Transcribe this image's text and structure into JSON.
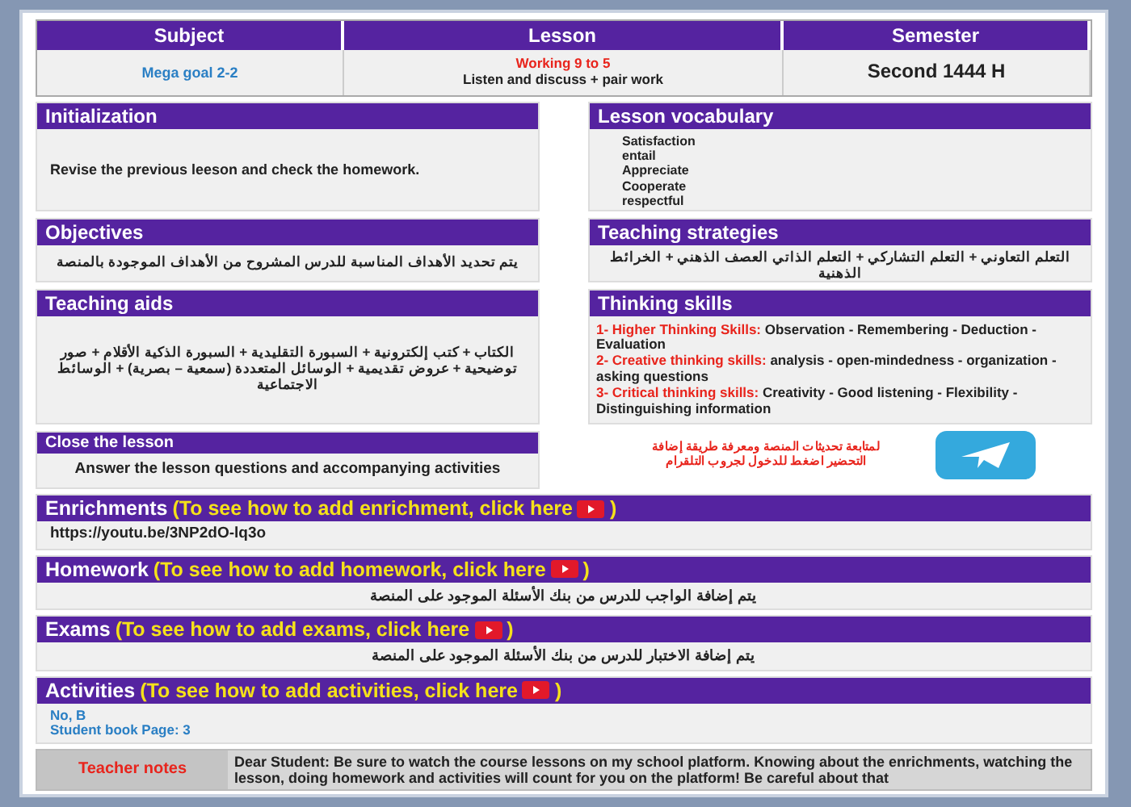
{
  "header": {
    "columns": [
      "Subject",
      "Lesson",
      "Semester"
    ],
    "subject": "Mega goal 2-2",
    "lesson_title": "Working 9 to 5",
    "lesson_detail": "Listen and discuss + pair work",
    "semester": "Second 1444 H"
  },
  "initialization": {
    "title": "Initialization",
    "text": "Revise the previous leeson and check the homework."
  },
  "objectives": {
    "title": "Objectives",
    "text": "يتم تحديد الأهداف المناسبة للدرس المشروح من الأهداف الموجودة بالمنصة"
  },
  "teaching_aids": {
    "title": "Teaching aids",
    "text": "الكتاب + كتب إلكترونية + السبورة التقليدية + السبورة الذكية الأقلام + صور توضيحية + عروض تقديمية + الوسائل المتعددة (سمعية – بصرية) + الوسائط الاجتماعية"
  },
  "close_lesson": {
    "title": "Close the lesson",
    "text": "Answer the lesson questions and accompanying activities"
  },
  "vocabulary": {
    "title": "Lesson vocabulary",
    "words": [
      "Satisfaction",
      "entail",
      "Appreciate",
      "Cooperate",
      "respectful"
    ]
  },
  "strategies": {
    "title": "Teaching strategies",
    "text": "التعلم التعاوني + التعلم التشاركي + التعلم الذاتي العصف الذهني + الخرائط الذهنية"
  },
  "thinking_skills": {
    "title": "Thinking skills",
    "items": [
      {
        "label": "1- Higher Thinking Skills:",
        "text": "Observation - Remembering - Deduction - Evaluation"
      },
      {
        "label": "2- Creative thinking skills:",
        "text": "analysis - open-mindedness - organization - asking questions"
      },
      {
        "label": "3- Critical thinking skills:",
        "text": "Creativity - Good listening - Flexibility - Distinguishing information"
      }
    ]
  },
  "telegram": {
    "text": "لمتابعة تحديثات المنصة ومعرفة طريقة إضافة التحضير اضغط للدخول لجروب التلقرام"
  },
  "sections": [
    {
      "title": "Enrichments",
      "hint": "(To see how to add enrichment, click here",
      "hint_end": ")",
      "kind": "link",
      "text": "https://youtu.be/3NP2dO-lq3o"
    },
    {
      "title": "Homework",
      "hint": "(To see how to add homework, click here",
      "hint_end": ")",
      "kind": "arabic",
      "text": "يتم إضافة الواجب للدرس من بنك الأسئلة الموجود على المنصة"
    },
    {
      "title": "Exams",
      "hint": "(To see how to add exams, click here",
      "hint_end": ")",
      "kind": "arabic",
      "text": "يتم إضافة الاختبار للدرس من بنك الأسئلة الموجود على المنصة"
    },
    {
      "title": "Activities",
      "hint": "(To see how to add activities, click here",
      "hint_end": ")",
      "kind": "lines",
      "lines": [
        "No, B",
        "Student book Page: 3"
      ]
    }
  ],
  "teacher_notes": {
    "label": "Teacher notes",
    "text": "Dear Student: Be sure to watch the course lessons on my school platform. Knowing about the enrichments, watching the lesson, doing homework and activities will count for you on the platform! Be careful about that"
  }
}
